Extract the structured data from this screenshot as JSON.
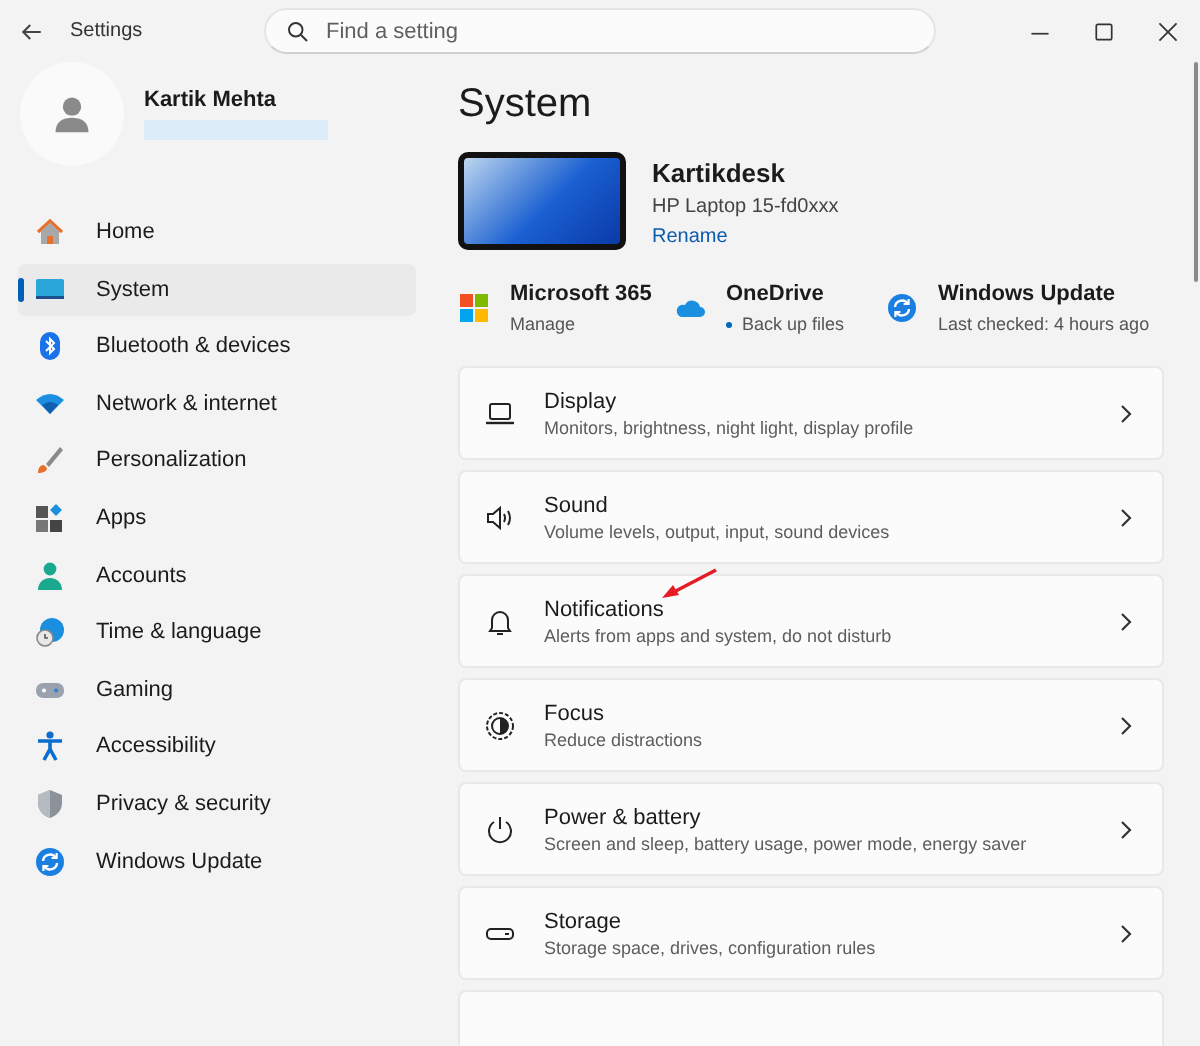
{
  "window": {
    "title": "Settings"
  },
  "search": {
    "placeholder": "Find a setting"
  },
  "account": {
    "name": "Kartik Mehta"
  },
  "sidebar": {
    "items": [
      {
        "kind": "home",
        "label": "Home",
        "selected": false
      },
      {
        "kind": "system",
        "label": "System",
        "selected": true
      },
      {
        "kind": "bluetooth",
        "label": "Bluetooth & devices",
        "selected": false
      },
      {
        "kind": "network",
        "label": "Network & internet",
        "selected": false
      },
      {
        "kind": "personalization",
        "label": "Personalization",
        "selected": false
      },
      {
        "kind": "apps",
        "label": "Apps",
        "selected": false
      },
      {
        "kind": "accounts",
        "label": "Accounts",
        "selected": false
      },
      {
        "kind": "time",
        "label": "Time & language",
        "selected": false
      },
      {
        "kind": "gaming",
        "label": "Gaming",
        "selected": false
      },
      {
        "kind": "accessibility",
        "label": "Accessibility",
        "selected": false
      },
      {
        "kind": "privacy",
        "label": "Privacy & security",
        "selected": false
      },
      {
        "kind": "update",
        "label": "Windows Update",
        "selected": false
      }
    ]
  },
  "page": {
    "title": "System"
  },
  "device": {
    "name": "Kartikdesk",
    "model": "HP Laptop 15-fd0xxx",
    "link": "Rename"
  },
  "quick_links": [
    {
      "kind": "m365",
      "title": "Microsoft 365",
      "subtitle": "Manage"
    },
    {
      "kind": "onedrive",
      "title": "OneDrive",
      "subtitle": "Back up files"
    },
    {
      "kind": "update",
      "title": "Windows Update",
      "subtitle": "Last checked: 4 hours ago"
    }
  ],
  "categories": [
    {
      "kind": "display",
      "title": "Display",
      "subtitle": "Monitors, brightness, night light, display profile",
      "marked": false
    },
    {
      "kind": "sound",
      "title": "Sound",
      "subtitle": "Volume levels, output, input, sound devices",
      "marked": false
    },
    {
      "kind": "notifications",
      "title": "Notifications",
      "subtitle": "Alerts from apps and system, do not disturb",
      "marked": true
    },
    {
      "kind": "focus",
      "title": "Focus",
      "subtitle": "Reduce distractions",
      "marked": false
    },
    {
      "kind": "power",
      "title": "Power & battery",
      "subtitle": "Screen and sleep, battery usage, power mode, energy saver",
      "marked": false
    },
    {
      "kind": "storage",
      "title": "Storage",
      "subtitle": "Storage space, drives, configuration rules",
      "marked": false
    },
    {
      "kind": "cut-off",
      "marked": false
    }
  ]
}
